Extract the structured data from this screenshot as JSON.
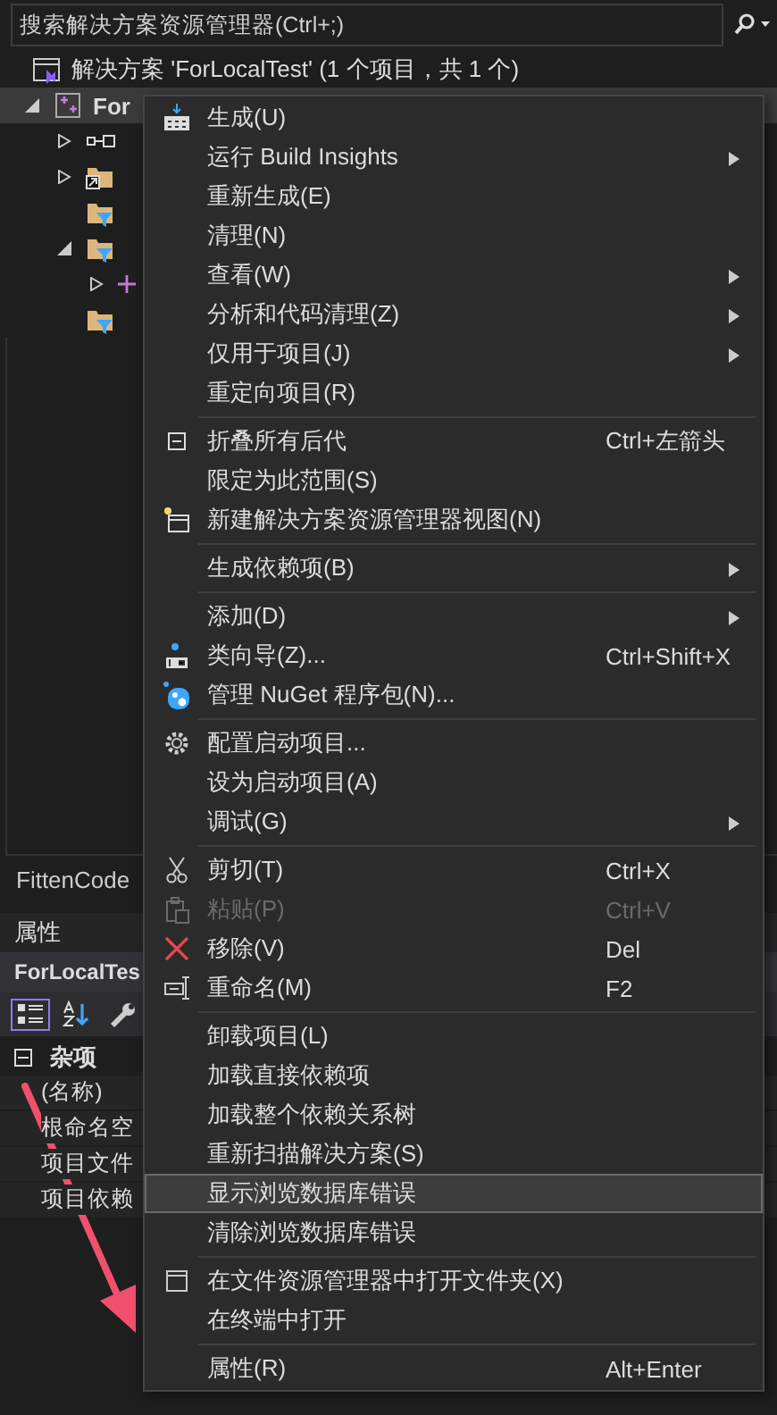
{
  "search": {
    "placeholder": "搜索解决方案资源管理器(Ctrl+;)"
  },
  "solution": {
    "label": "解决方案 'ForLocalTest' (1 个项目，共 1 个)"
  },
  "project": {
    "label": "For",
    "expanded": true,
    "selected": true,
    "children": [
      {
        "kind": "references",
        "expanded": false
      },
      {
        "kind": "folder-link",
        "expanded": false
      },
      {
        "kind": "filter-folder"
      },
      {
        "kind": "filter-folder",
        "expanded": true,
        "children": [
          {
            "kind": "item",
            "expanded": false
          }
        ]
      },
      {
        "kind": "filter-folder"
      }
    ]
  },
  "bottom_tab": {
    "label": "FittenCode"
  },
  "properties": {
    "title": "属性",
    "object": "ForLocalTes",
    "toolbar": [
      {
        "selected": true
      },
      {
        "selected": false
      },
      {
        "selected": false
      }
    ],
    "category": {
      "label": "杂项",
      "expanded": true
    },
    "rows": [
      "(名称)",
      "根命名空",
      "项目文件",
      "项目依赖"
    ]
  },
  "context_menu": {
    "items": [
      {
        "kind": "item",
        "label": "生成(U)",
        "submenu": false,
        "disabled": false,
        "selected": false
      },
      {
        "kind": "item",
        "label": "运行 Build Insights",
        "submenu": true,
        "disabled": false,
        "selected": false
      },
      {
        "kind": "item",
        "label": "重新生成(E)",
        "submenu": false,
        "disabled": false,
        "selected": false
      },
      {
        "kind": "item",
        "label": "清理(N)",
        "submenu": false,
        "disabled": false,
        "selected": false
      },
      {
        "kind": "item",
        "label": "查看(W)",
        "submenu": true,
        "disabled": false,
        "selected": false
      },
      {
        "kind": "item",
        "label": "分析和代码清理(Z)",
        "submenu": true,
        "disabled": false,
        "selected": false
      },
      {
        "kind": "item",
        "label": "仅用于项目(J)",
        "submenu": true,
        "disabled": false,
        "selected": false
      },
      {
        "kind": "item",
        "label": "重定向项目(R)",
        "submenu": false,
        "disabled": false,
        "selected": false
      },
      {
        "kind": "separator"
      },
      {
        "kind": "item",
        "label": "折叠所有后代",
        "shortcut": "Ctrl+左箭头",
        "submenu": false,
        "disabled": false,
        "selected": false
      },
      {
        "kind": "item",
        "label": "限定为此范围(S)",
        "submenu": false,
        "disabled": false,
        "selected": false
      },
      {
        "kind": "item",
        "label": "新建解决方案资源管理器视图(N)",
        "submenu": false,
        "disabled": false,
        "selected": false
      },
      {
        "kind": "separator"
      },
      {
        "kind": "item",
        "label": "生成依赖项(B)",
        "submenu": true,
        "disabled": false,
        "selected": false
      },
      {
        "kind": "separator"
      },
      {
        "kind": "item",
        "label": "添加(D)",
        "submenu": true,
        "disabled": false,
        "selected": false
      },
      {
        "kind": "item",
        "label": "类向导(Z)...",
        "shortcut": "Ctrl+Shift+X",
        "submenu": false,
        "disabled": false,
        "selected": false
      },
      {
        "kind": "item",
        "label": "管理 NuGet 程序包(N)...",
        "submenu": false,
        "disabled": false,
        "selected": false
      },
      {
        "kind": "separator"
      },
      {
        "kind": "item",
        "label": "配置启动项目...",
        "submenu": false,
        "disabled": false,
        "selected": false
      },
      {
        "kind": "item",
        "label": "设为启动项目(A)",
        "submenu": false,
        "disabled": false,
        "selected": false
      },
      {
        "kind": "item",
        "label": "调试(G)",
        "submenu": true,
        "disabled": false,
        "selected": false
      },
      {
        "kind": "separator"
      },
      {
        "kind": "item",
        "label": "剪切(T)",
        "shortcut": "Ctrl+X",
        "submenu": false,
        "disabled": false,
        "selected": false
      },
      {
        "kind": "item",
        "label": "粘贴(P)",
        "shortcut": "Ctrl+V",
        "submenu": false,
        "disabled": true,
        "selected": false
      },
      {
        "kind": "item",
        "label": "移除(V)",
        "shortcut": "Del",
        "submenu": false,
        "disabled": false,
        "selected": false
      },
      {
        "kind": "item",
        "label": "重命名(M)",
        "shortcut": "F2",
        "submenu": false,
        "disabled": false,
        "selected": false
      },
      {
        "kind": "separator"
      },
      {
        "kind": "item",
        "label": "卸载项目(L)",
        "submenu": false,
        "disabled": false,
        "selected": false
      },
      {
        "kind": "item",
        "label": "加载直接依赖项",
        "submenu": false,
        "disabled": false,
        "selected": false
      },
      {
        "kind": "item",
        "label": "加载整个依赖关系树",
        "submenu": false,
        "disabled": false,
        "selected": false
      },
      {
        "kind": "item",
        "label": "重新扫描解决方案(S)",
        "submenu": false,
        "disabled": false,
        "selected": false
      },
      {
        "kind": "item",
        "label": "显示浏览数据库错误",
        "submenu": false,
        "disabled": false,
        "selected": true
      },
      {
        "kind": "item",
        "label": "清除浏览数据库错误",
        "submenu": false,
        "disabled": false,
        "selected": false
      },
      {
        "kind": "separator"
      },
      {
        "kind": "item",
        "label": "在文件资源管理器中打开文件夹(X)",
        "submenu": false,
        "disabled": false,
        "selected": false
      },
      {
        "kind": "item",
        "label": "在终端中打开",
        "submenu": false,
        "disabled": false,
        "selected": false
      },
      {
        "kind": "separator"
      },
      {
        "kind": "item",
        "label": "属性(R)",
        "shortcut": "Alt+Enter",
        "submenu": false,
        "disabled": false,
        "selected": false
      }
    ]
  }
}
